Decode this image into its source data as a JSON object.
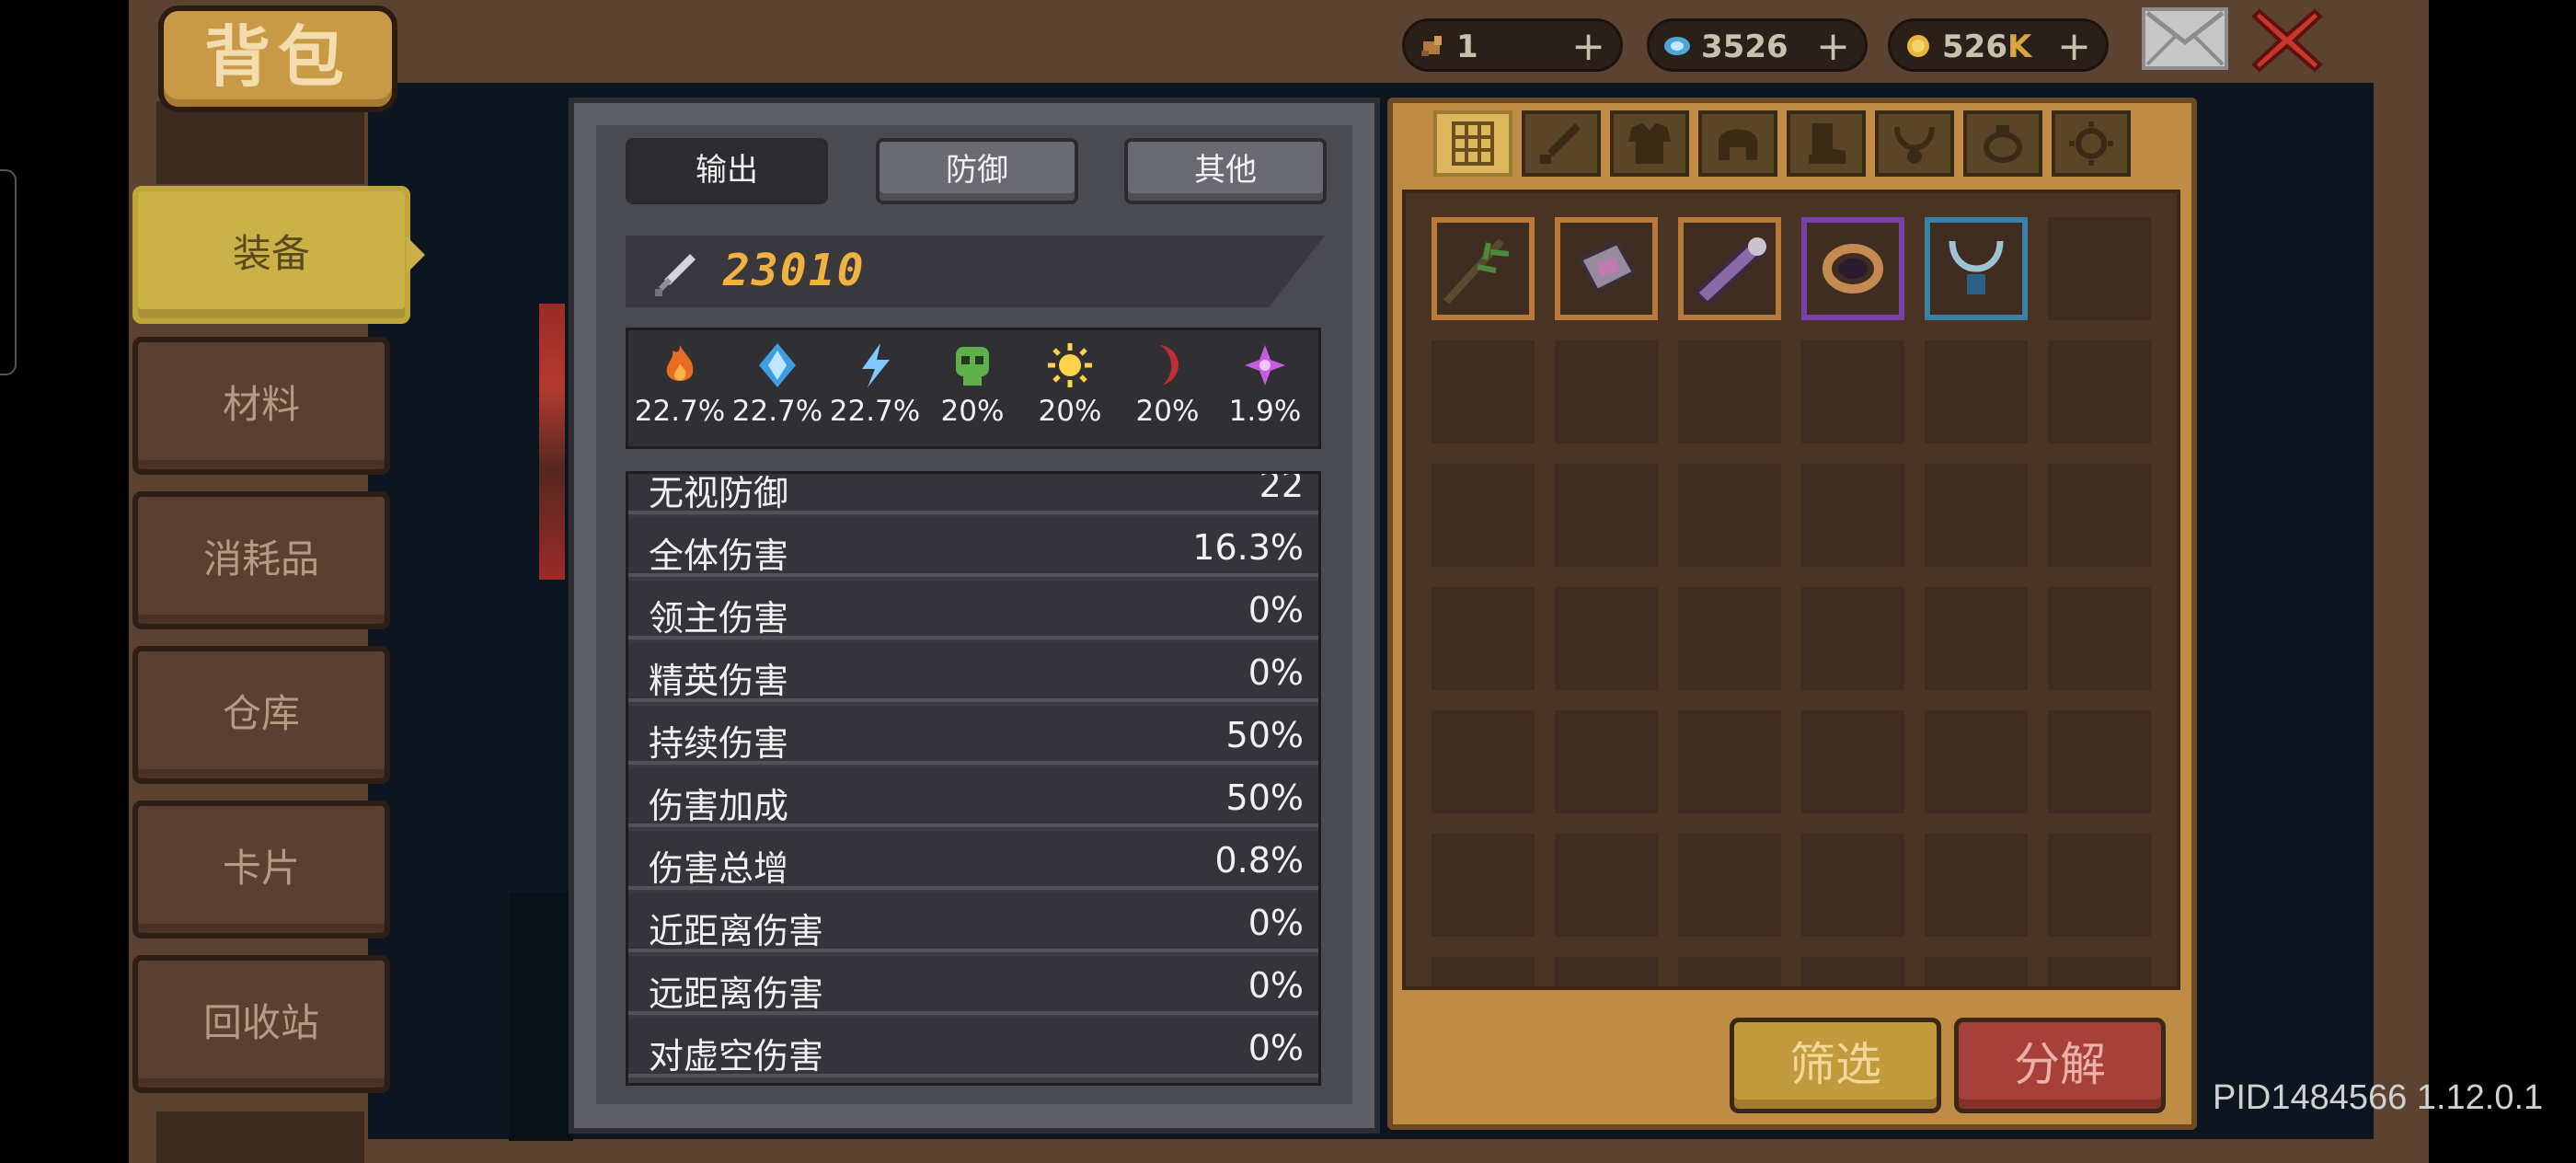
{
  "header": {
    "title": "背包"
  },
  "currencies": [
    {
      "name": "scroll",
      "value": "1",
      "value_suffix": "",
      "plus": "+"
    },
    {
      "name": "gem",
      "value": "3526",
      "value_suffix": "",
      "plus": "+"
    },
    {
      "name": "gold",
      "value": "526",
      "value_suffix": "K",
      "plus": "+"
    }
  ],
  "sidebar": {
    "items": [
      {
        "label": "装备",
        "active": true
      },
      {
        "label": "材料",
        "active": false
      },
      {
        "label": "消耗品",
        "active": false
      },
      {
        "label": "仓库",
        "active": false
      },
      {
        "label": "卡片",
        "active": false
      },
      {
        "label": "回收站",
        "active": false
      }
    ]
  },
  "stats": {
    "tabs": [
      {
        "label": "输出",
        "active": true
      },
      {
        "label": "防御",
        "active": false
      },
      {
        "label": "其他",
        "active": false
      }
    ],
    "attack_power": "23010",
    "elements": [
      {
        "icon": "fire-icon",
        "value": "22.7%"
      },
      {
        "icon": "ice-crystal-icon",
        "value": "22.7%"
      },
      {
        "icon": "lightning-icon",
        "value": "22.7%"
      },
      {
        "icon": "poison-skull-icon",
        "value": "20%"
      },
      {
        "icon": "light-sun-icon",
        "value": "20%"
      },
      {
        "icon": "dark-moon-icon",
        "value": "20%"
      },
      {
        "icon": "arcane-star-icon",
        "value": "1.9%"
      }
    ],
    "rows": [
      {
        "label": "无视防御",
        "value": "22"
      },
      {
        "label": "全体伤害",
        "value": "16.3%"
      },
      {
        "label": "领主伤害",
        "value": "0%"
      },
      {
        "label": "精英伤害",
        "value": "0%"
      },
      {
        "label": "持续伤害",
        "value": "50%"
      },
      {
        "label": "伤害加成",
        "value": "50%"
      },
      {
        "label": "伤害总增",
        "value": "0.8%"
      },
      {
        "label": "近距离伤害",
        "value": "0%"
      },
      {
        "label": "远距离伤害",
        "value": "0%"
      },
      {
        "label": "对虚空伤害",
        "value": "0%"
      }
    ]
  },
  "inventory": {
    "categories": [
      "all-grid-icon",
      "weapon-sword-icon",
      "armor-chest-icon",
      "helmet-icon",
      "boots-icon",
      "necklace-icon",
      "ring-icon",
      "gear-icon"
    ],
    "items": [
      {
        "icon": "branch-staff-icon",
        "rarity_color": "#b8793a"
      },
      {
        "icon": "rune-stone-icon",
        "rarity_color": "#b8793a"
      },
      {
        "icon": "scroll-bracer-icon",
        "rarity_color": "#b8793a"
      },
      {
        "icon": "bronze-ring-icon",
        "rarity_color": "#7a3fa8"
      },
      {
        "icon": "blue-amulet-icon",
        "rarity_color": "#3a7fa6"
      }
    ],
    "filter_label": "筛选",
    "decompose_label": "分解"
  },
  "footer": {
    "pid_text": "PID1484566 1.12.0.1"
  }
}
